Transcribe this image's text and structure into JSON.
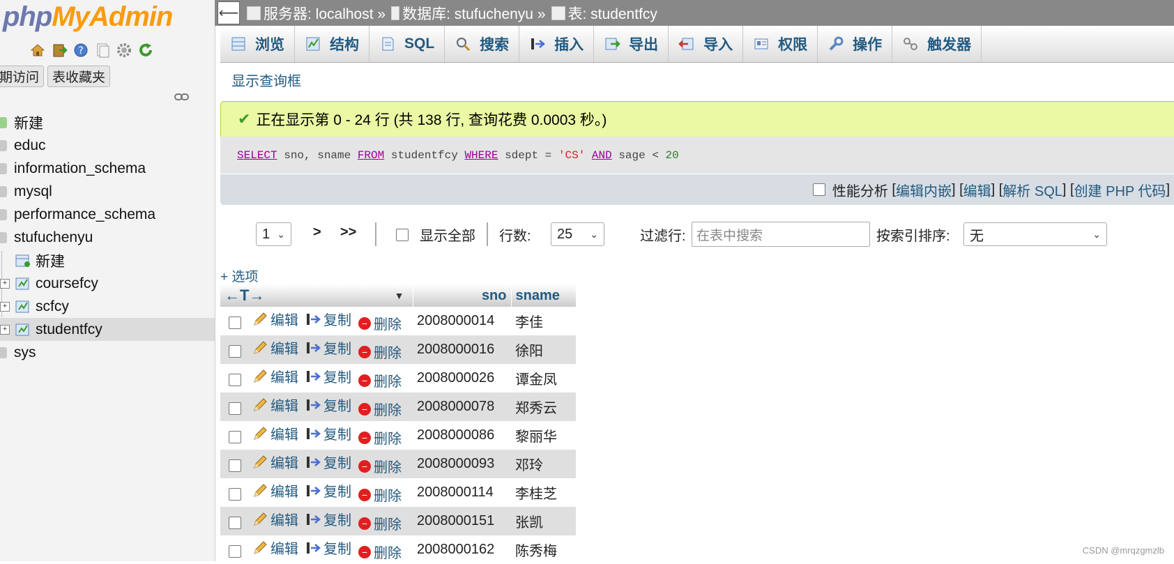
{
  "sidebar": {
    "logo_php": "php",
    "logo_mya": "MyAdmin",
    "tool_icons": [
      "home-icon",
      "exit-icon",
      "help-icon",
      "docs-icon",
      "settings-icon",
      "reload-icon"
    ],
    "tabs": [
      "期访问",
      "表收藏夹"
    ],
    "tree": [
      {
        "label": "新建",
        "type": "new"
      },
      {
        "label": "educ",
        "type": "db"
      },
      {
        "label": "information_schema",
        "type": "db"
      },
      {
        "label": "mysql",
        "type": "db"
      },
      {
        "label": "performance_schema",
        "type": "db"
      },
      {
        "label": "stufuchenyu",
        "type": "db"
      },
      {
        "label": "新建",
        "type": "new-table"
      },
      {
        "label": "coursefcy",
        "type": "table"
      },
      {
        "label": "scfcy",
        "type": "table"
      },
      {
        "label": "studentfcy",
        "type": "table"
      },
      {
        "label": "sys",
        "type": "db"
      }
    ]
  },
  "breadcrumb": {
    "server": "服务器: localhost »",
    "database": "数据库: stufuchenyu »",
    "table": "表: studentfcy"
  },
  "tabs": [
    "浏览",
    "结构",
    "SQL",
    "搜索",
    "插入",
    "导出",
    "导入",
    "权限",
    "操作",
    "触发器"
  ],
  "show_query": "显示查询框",
  "success_message": "正在显示第 0 - 24 行 (共 138 行, 查询花费 0.0003 秒。)",
  "sql": {
    "kw_select": "SELECT",
    "cols": " sno, sname ",
    "kw_from": "FROM",
    "table": " studentfcy ",
    "kw_where": "WHERE",
    "cond1": " sdept = ",
    "str": "'CS'",
    "kw_and": "AND",
    "cond2": " sage < ",
    "num": "20"
  },
  "sql_tools": {
    "profiling": "性能分析",
    "open": " [",
    "edit_inline": "编辑内嵌",
    "sep1": "] [",
    "edit": "编辑",
    "sep2": "] [",
    "explain": "解析 SQL",
    "sep3": "] [",
    "php": "创建 PHP 代码",
    "close": "]"
  },
  "nav": {
    "page": "1",
    "next": ">",
    "last": ">>",
    "show_all": "显示全部",
    "rows_label": "行数:",
    "rows_value": "25",
    "filter_label": "过滤行:",
    "filter_placeholder": "在表中搜索",
    "sort_label": "按索引排序:",
    "sort_value": "无"
  },
  "options_link": "+ 选项",
  "table": {
    "headers": [
      "sno",
      "sname"
    ],
    "actions": {
      "edit": "编辑",
      "copy": "复制",
      "delete": "删除"
    },
    "rows": [
      {
        "sno": "2008000014",
        "sname": "李佳"
      },
      {
        "sno": "2008000016",
        "sname": "徐阳"
      },
      {
        "sno": "2008000026",
        "sname": "谭金凤"
      },
      {
        "sno": "2008000078",
        "sname": "郑秀云"
      },
      {
        "sno": "2008000086",
        "sname": "黎丽华"
      },
      {
        "sno": "2008000093",
        "sname": "邓玲"
      },
      {
        "sno": "2008000114",
        "sname": "李桂芝"
      },
      {
        "sno": "2008000151",
        "sname": "张凯"
      },
      {
        "sno": "2008000162",
        "sname": "陈秀梅"
      }
    ]
  },
  "watermark": "CSDN @mrqzgmzlb"
}
